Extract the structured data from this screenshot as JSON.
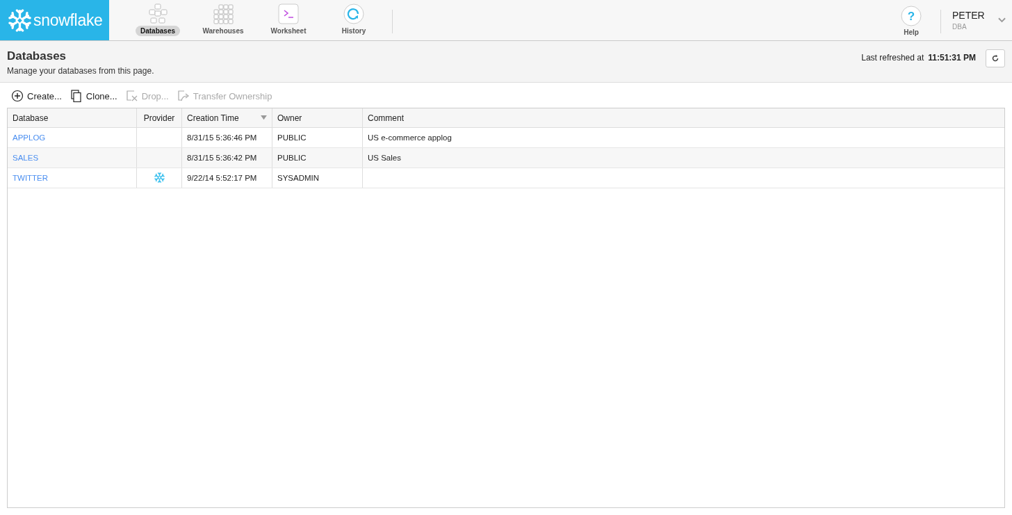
{
  "logo": {
    "text": "snowflake"
  },
  "nav": [
    {
      "kind": "databases",
      "label": "Databases",
      "selected": true
    },
    {
      "kind": "warehouses",
      "label": "Warehouses",
      "selected": false
    },
    {
      "kind": "worksheet",
      "label": "Worksheet",
      "selected": false
    },
    {
      "kind": "history",
      "label": "History",
      "selected": false
    }
  ],
  "help": {
    "label": "Help",
    "glyph": "?"
  },
  "user": {
    "name": "PETER",
    "role": "DBA"
  },
  "page": {
    "title": "Databases",
    "subtitle": "Manage your databases from this page.",
    "refreshed_label": "Last refreshed at",
    "refreshed_time": "11:51:31 PM"
  },
  "toolbar": [
    {
      "kind": "create",
      "label": "Create...",
      "disabled": false
    },
    {
      "kind": "clone",
      "label": "Clone...",
      "disabled": false
    },
    {
      "kind": "drop",
      "label": "Drop...",
      "disabled": true
    },
    {
      "kind": "transfer",
      "label": "Transfer Ownership",
      "disabled": true
    }
  ],
  "table": {
    "columns": [
      {
        "label": "Database",
        "sorted": false
      },
      {
        "label": "Provider",
        "sorted": false
      },
      {
        "label": "Creation Time",
        "sorted": true
      },
      {
        "label": "Owner",
        "sorted": false
      },
      {
        "label": "Comment",
        "sorted": false
      }
    ],
    "rows": [
      {
        "database": "APPLOG",
        "shared": false,
        "created": "8/31/15 5:36:46 PM",
        "owner": "PUBLIC",
        "comment": "US e-commerce applog"
      },
      {
        "database": "SALES",
        "shared": false,
        "created": "8/31/15 5:36:42 PM",
        "owner": "PUBLIC",
        "comment": "US Sales"
      },
      {
        "database": "TWITTER",
        "shared": true,
        "created": "9/22/14 5:52:17 PM",
        "owner": "SYSADMIN",
        "comment": ""
      }
    ]
  }
}
